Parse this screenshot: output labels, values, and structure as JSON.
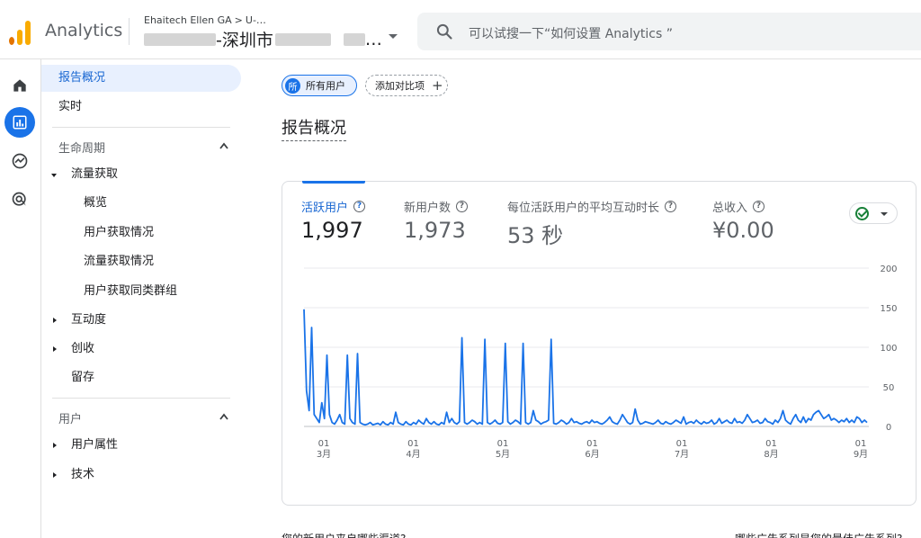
{
  "header": {
    "app_name": "Analytics",
    "account_path": "Ehaitech Ellen GA",
    "account_path_suffix": "U-…",
    "property_name": "-深圳市",
    "property_ellipsis": "…",
    "search_placeholder": "可以试搜一下“如何设置 Analytics ”"
  },
  "rail": {
    "items": [
      {
        "name": "home-icon",
        "active": false
      },
      {
        "name": "reports-icon",
        "active": true
      },
      {
        "name": "explore-icon",
        "active": false
      },
      {
        "name": "advertising-icon",
        "active": false
      }
    ]
  },
  "sidebar": {
    "overview": "报告概况",
    "realtime": "实时",
    "lifecycle": "生命周期",
    "acquisition": "流量获取",
    "acq_items": [
      "概览",
      "用户获取情况",
      "流量获取情况",
      "用户获取同类群组"
    ],
    "engagement": "互动度",
    "monetization": "创收",
    "retention": "留存",
    "user_section": "用户",
    "user_attributes": "用户属性",
    "tech": "技术"
  },
  "main": {
    "chip_avatar": "所",
    "chip_all_users": "所有用户",
    "chip_add_compare": "添加对比项",
    "page_title": "报告概况",
    "metrics": [
      {
        "label": "活跃用户",
        "value": "1,997",
        "active": true
      },
      {
        "label": "新用户数",
        "value": "1,973",
        "active": false
      },
      {
        "label": "每位活跃用户的平均互动时长",
        "value": "53 秒",
        "active": false
      },
      {
        "label": "总收入",
        "value": "¥0.00",
        "active": false
      }
    ],
    "bottom_left": "您的新用户来自哪些渠道?",
    "bottom_right": "哪些广告系列是您的最佳广告系列?"
  },
  "chart_data": {
    "type": "line",
    "series": [
      {
        "values": [
          148,
          45,
          20,
          125,
          15,
          10,
          5,
          30,
          10,
          90,
          15,
          5,
          3,
          8,
          15,
          5,
          3,
          90,
          10,
          5,
          3,
          92,
          5,
          3,
          2,
          3,
          5,
          2,
          3,
          4,
          2,
          6,
          3,
          2,
          5,
          3,
          18,
          5,
          3,
          2,
          6,
          3,
          2,
          5,
          3,
          8,
          5,
          3,
          10,
          5,
          3,
          6,
          3,
          2,
          5,
          3,
          18,
          5,
          10,
          5,
          3,
          6,
          112,
          5,
          3,
          5,
          8,
          6,
          3,
          5,
          3,
          110,
          5,
          3,
          5,
          8,
          4,
          3,
          5,
          105,
          6,
          3,
          5,
          8,
          6,
          3,
          105,
          5,
          3,
          5,
          20,
          8,
          6,
          3,
          5,
          6,
          8,
          110,
          4,
          3,
          5,
          8,
          6,
          3,
          5,
          10,
          5,
          6,
          4,
          3,
          5,
          6,
          4,
          8,
          5,
          6,
          4,
          3,
          5,
          8,
          12,
          6,
          4,
          3,
          8,
          15,
          10,
          5,
          3,
          5,
          22,
          8,
          3,
          4,
          6,
          5,
          4,
          3,
          5,
          8,
          4,
          3,
          6,
          4,
          3,
          5,
          8,
          6,
          4,
          12,
          3,
          5,
          6,
          4,
          8,
          5,
          3,
          6,
          4,
          5,
          8,
          3,
          5,
          10,
          4,
          6,
          8,
          5,
          4,
          10,
          5,
          6,
          4,
          8,
          15,
          10,
          5,
          6,
          8,
          4,
          5,
          10,
          6,
          5,
          3,
          8,
          5,
          10,
          20,
          8,
          5,
          3,
          10,
          15,
          8,
          5,
          12,
          5,
          10,
          8,
          15,
          18,
          20,
          15,
          10,
          12,
          15,
          8,
          10,
          8,
          5,
          8,
          6,
          10,
          5,
          8,
          5,
          12,
          10,
          5,
          8,
          5
        ]
      }
    ],
    "x_ticks": [
      {
        "day": "01",
        "month": "3月"
      },
      {
        "day": "01",
        "month": "4月"
      },
      {
        "day": "01",
        "month": "5月"
      },
      {
        "day": "01",
        "month": "6月"
      },
      {
        "day": "01",
        "month": "7月"
      },
      {
        "day": "01",
        "month": "8月"
      },
      {
        "day": "01",
        "month": "9月"
      }
    ],
    "y_ticks": [
      0,
      50,
      100,
      150,
      200
    ],
    "ylim": [
      0,
      200
    ],
    "color": "#1a73e8",
    "grid": true,
    "y_axis_side": "right"
  }
}
